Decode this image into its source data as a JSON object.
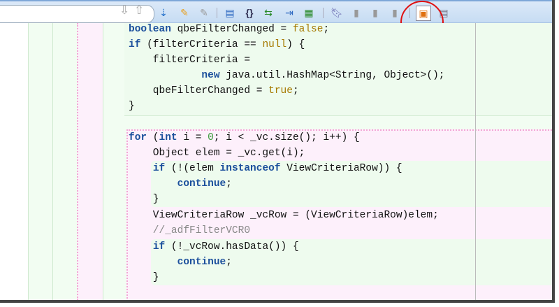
{
  "toolbar": {
    "search": {
      "value": "",
      "placeholder": ""
    },
    "buttons": [
      "find-previous",
      "find-next",
      "toggle-line-numbers",
      "highlight",
      "clear-highlight",
      "source-view",
      "brace-match",
      "compare",
      "reformat",
      "bookmark",
      "previous-bookmark",
      "next-bookmark",
      "clear-bookmarks",
      "code-folding-view",
      "split-view"
    ]
  },
  "code": {
    "l1": [
      "boolean",
      " qbeFilterChanged = ",
      "false",
      ";"
    ],
    "l2": [
      "if",
      " (filterCriteria == ",
      "null",
      ") {"
    ],
    "l3": "    filterCriteria =",
    "l4": [
      "            ",
      "new",
      " java.util.HashMap<String, Object>();"
    ],
    "l5": [
      "    qbeFilterChanged = ",
      "true",
      ";"
    ],
    "l6": "}",
    "l7": [
      "for",
      " (",
      "int",
      " i = ",
      "0",
      "; i < _vc.size(); i++) {"
    ],
    "l8": "    Object elem = _vc.get(i);",
    "l9": [
      "    ",
      "if",
      " (!(elem ",
      "instanceof",
      " ViewCriteriaRow)) {"
    ],
    "l10": [
      "        ",
      "continue",
      ";"
    ],
    "l11": "    }",
    "l12": "    ViewCriteriaRow _vcRow = (ViewCriteriaRow)elem;",
    "l13": "    //_adfFilterVCR0",
    "l14": [
      "    ",
      "if",
      " (!_vcRow.hasData()) {"
    ],
    "l15": [
      "        ",
      "continue",
      ";"
    ],
    "l16": "    }"
  },
  "colors": {
    "highlight_circle": "#e01010",
    "keyword": "#1b4f9c",
    "literal": "#a67a00"
  }
}
